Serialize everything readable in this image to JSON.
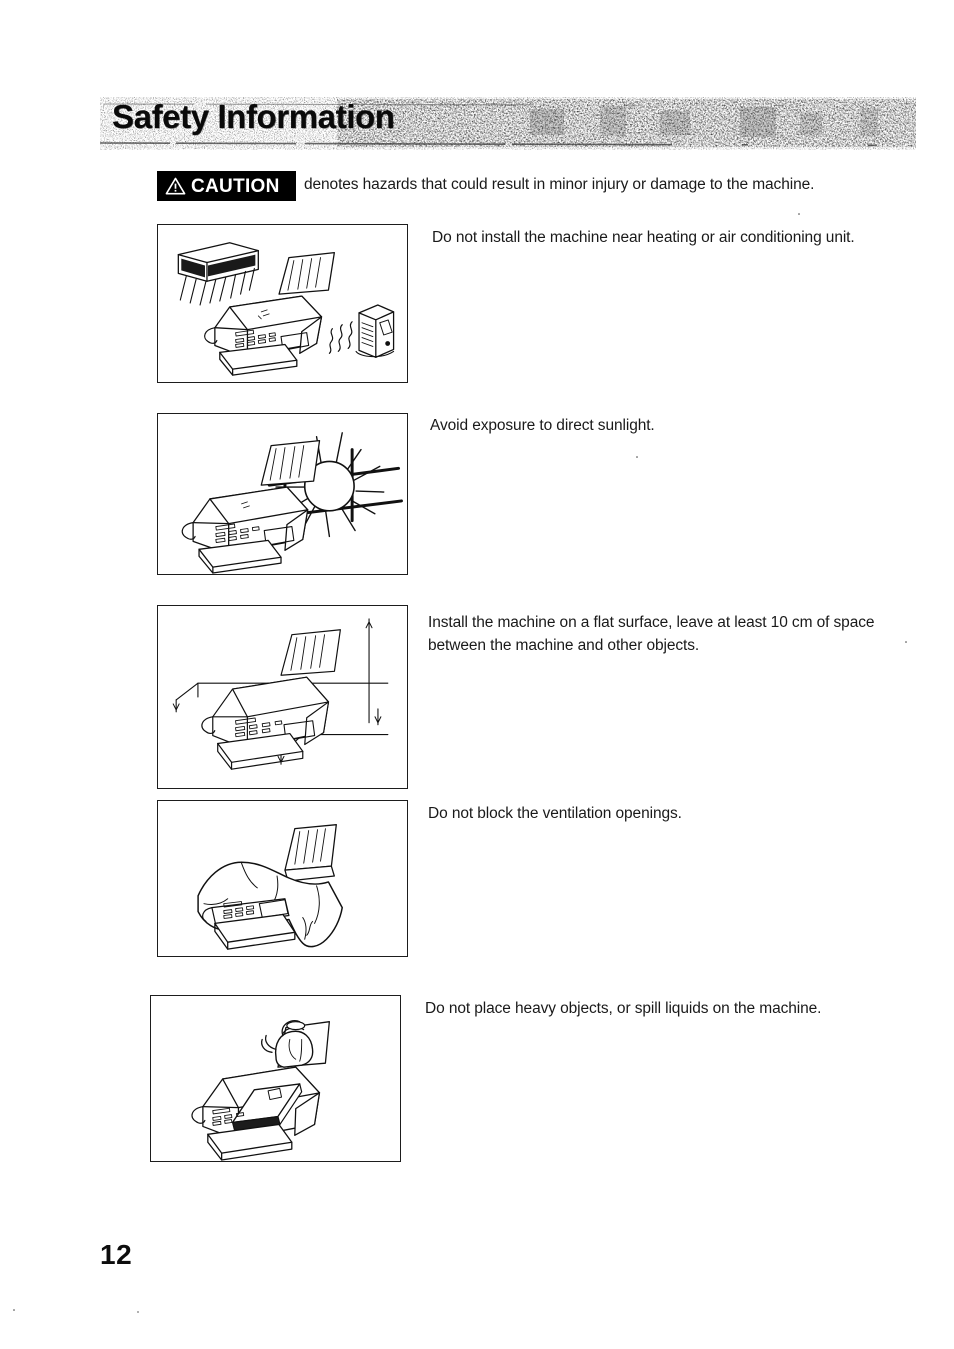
{
  "document": {
    "title": "Safety Information",
    "page_number": "12"
  },
  "caution": {
    "badge_label": "CAUTION",
    "badge_icon": "warning-triangle-icon",
    "description": "denotes hazards that could result in minor injury or damage to the machine."
  },
  "items": [
    {
      "id": "heating-air-conditioning",
      "text": "Do not install the machine near heating or air conditioning unit.",
      "figure": "fax-machine-between-air-conditioner-and-heater"
    },
    {
      "id": "direct-sunlight",
      "text": "Avoid exposure to direct sunlight.",
      "figure": "fax-machine-beside-sun-and-window"
    },
    {
      "id": "flat-surface-clearance",
      "text": "Install the machine on a flat surface, leave at least 10 cm of space between the machine and other objects.",
      "figure": "fax-machine-on-flat-surface-with-clearance-dimensions"
    },
    {
      "id": "ventilation-openings",
      "text": "Do not block the ventilation openings.",
      "figure": "fax-machine-covered-with-cloth"
    },
    {
      "id": "heavy-objects-liquids",
      "text": "Do not place heavy objects, or spill liquids on the machine.",
      "figure": "fax-machine-with-teapot-and-heavy-object"
    }
  ]
}
